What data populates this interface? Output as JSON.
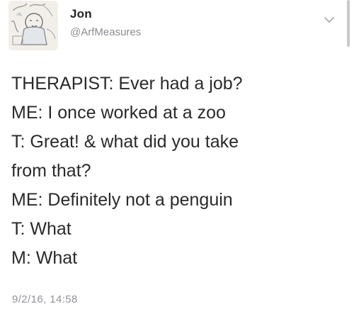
{
  "tweet": {
    "author": {
      "display_name": "Jon",
      "handle": "@ArfMeasures",
      "avatar_icon": "sketch-portrait-avatar"
    },
    "menu_icon": "chevron-down-icon",
    "lines": [
      "THERAPIST: Ever had a job?",
      "ME: I once worked at a zoo",
      "T: Great! & what did you take",
      "from that?",
      "ME: Definitely not a penguin",
      "T: What",
      "M: What"
    ],
    "timestamp": "9/2/16, 14:58"
  },
  "colors": {
    "text": "#2a2a2a",
    "secondary_text": "#8a8d91",
    "background": "#ffffff"
  }
}
